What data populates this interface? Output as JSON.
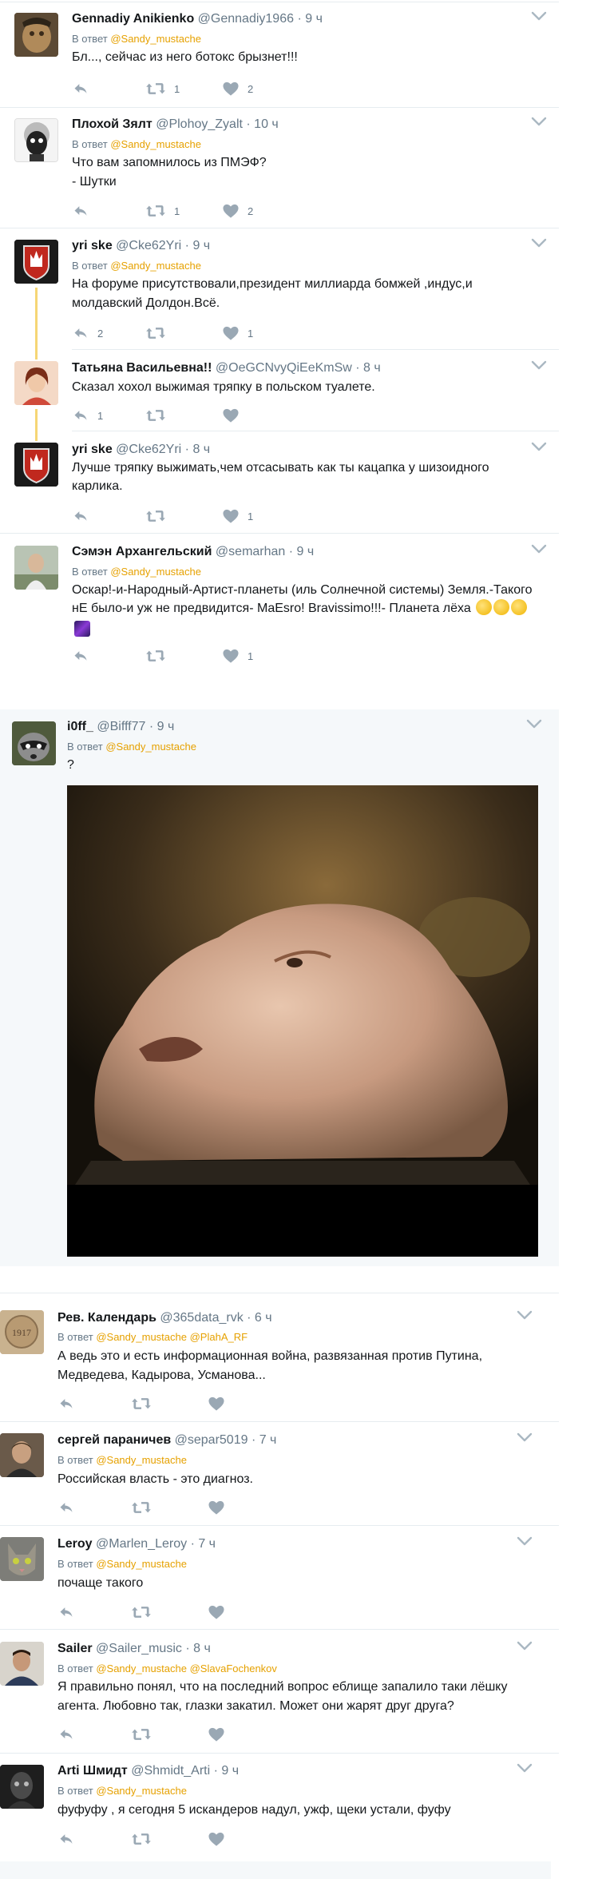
{
  "tweets": [
    {
      "name": "Gennadiy Anikienko",
      "handle": "@Gennadiy1966",
      "time": "· 9 ч",
      "reply_prefix": "В ответ",
      "reply_to": "@Sandy_mustache",
      "text": "Бл..., сейчас из него ботокс брызнет!!!",
      "retweets": "1",
      "likes": "2"
    },
    {
      "name": "Плохой Зялт",
      "handle": "@Plohoy_Zyalt",
      "time": "· 10 ч",
      "reply_prefix": "В ответ",
      "reply_to": "@Sandy_mustache",
      "text_line1": "Что вам запомнилось из ПМЭФ?",
      "text_line2": "- Шутки",
      "retweets": "1",
      "likes": "2"
    },
    {
      "name": "yri ske",
      "handle": "@Cke62Yri",
      "time": "· 9 ч",
      "reply_prefix": "В ответ",
      "reply_to": "@Sandy_mustache",
      "text_line1": "На форуме присутствовали,президент миллиарда бомжей ,индус,и",
      "text_line2": "молдавский Долдон.Всё.",
      "replies": "2",
      "likes": "1"
    },
    {
      "name": "Татьяна Васильевна!!",
      "handle": "@OeGCNvyQiEeKmSw",
      "time": "· 8 ч",
      "text": "Сказал хохол выжимая тряпку в польском туалете.",
      "replies": "1"
    },
    {
      "name": "yri ske",
      "handle": "@Cke62Yri",
      "time": "· 8 ч",
      "text_line1": "Лучше тряпку  выжимать,чем отсасывать как ты кацапка у шизоидного",
      "text_line2": "карлика.",
      "likes": "1"
    },
    {
      "name": "Сэмэн Архангельский",
      "handle": "@semarhan",
      "time": "· 9 ч",
      "reply_prefix": "В ответ",
      "reply_to": "@Sandy_mustache",
      "text_line1": "Оскар!-и-Народный-Артист-планеты (иль Солнечной системы) Земля.-Такого",
      "text_line2": "нЕ было-и уж не предвидится- MaEsro! Bravissimo!!!- Планета лёха",
      "likes": "1"
    },
    {
      "name": "i0ff_",
      "handle": "@Bifff77",
      "time": "· 9 ч",
      "reply_prefix": "В ответ",
      "reply_to": "@Sandy_mustache",
      "text": "?"
    },
    {
      "name": "Рев. Календарь",
      "handle": "@365data_rvk",
      "time": "· 6 ч",
      "reply_prefix": "В ответ",
      "reply_to": "@Sandy_mustache",
      "reply_to2": "@PlahA_RF",
      "text_line1": "А ведь это и есть информационная война, развязанная против Путина,",
      "text_line2": "Медведева, Кадырова, Усманова..."
    },
    {
      "name": "сергей параничев",
      "handle": "@separ5019",
      "time": "· 7 ч",
      "reply_prefix": "В ответ",
      "reply_to": "@Sandy_mustache",
      "text": "Российская власть - это диагноз."
    },
    {
      "name": "Leroy",
      "handle": "@Marlen_Leroy",
      "time": "· 7 ч",
      "reply_prefix": "В ответ",
      "reply_to": "@Sandy_mustache",
      "text": "почаще такого"
    },
    {
      "name": "Sailer",
      "handle": "@Sailer_music",
      "time": "· 8 ч",
      "reply_prefix": "В ответ",
      "reply_to": "@Sandy_mustache",
      "reply_to2": "@SlavaFochenkov",
      "text_line1": "Я правильно понял, что на последний вопрос еблище запалило таки лёшку",
      "text_line2": "агента. Любовно так, глазки закатил. Может они жарят друг друга?"
    },
    {
      "name": "Arti Шмидт",
      "handle": "@Shmidt_Arti",
      "time": "· 9 ч",
      "reply_prefix": "В ответ",
      "reply_to": "@Sandy_mustache",
      "text": "фуфуфу , я сегодня 5 искандеров надул, ужф, щеки устали, фуфу"
    }
  ],
  "colors": {
    "accent": "#e6a100",
    "muted": "#657786",
    "icon": "#9aa8b4",
    "thread": "#f6d675",
    "highlight_bg": "#f5f8fa"
  },
  "icons": [
    "reply-icon",
    "retweet-icon",
    "like-icon",
    "chevron-down-icon",
    "clap-emoji",
    "galaxy-emoji"
  ]
}
